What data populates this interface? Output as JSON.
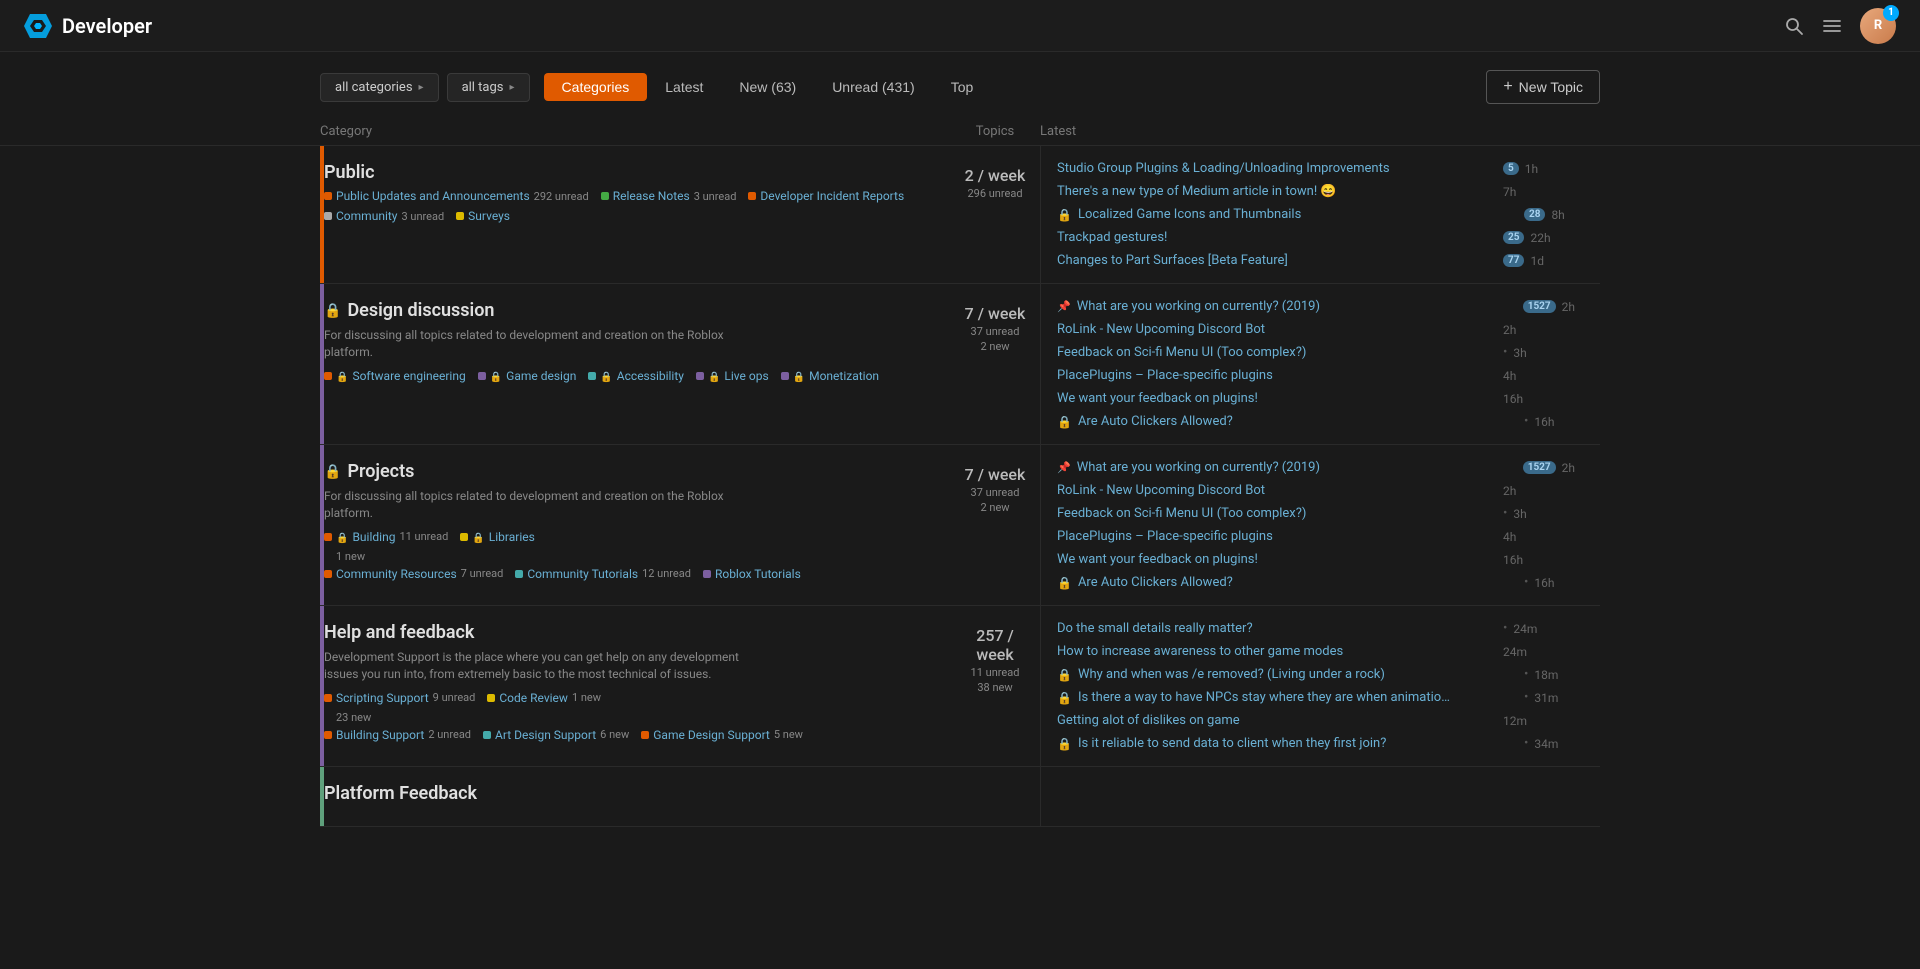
{
  "site": {
    "title": "Developer",
    "logo_text": "Developer"
  },
  "nav": {
    "search_label": "Search",
    "menu_label": "Menu",
    "notifications": "1",
    "avatar_initials": "R"
  },
  "filters": {
    "categories_label": "all categories",
    "tags_label": "all tags",
    "tabs": [
      {
        "id": "categories",
        "label": "Categories",
        "active": true
      },
      {
        "id": "latest",
        "label": "Latest",
        "active": false
      },
      {
        "id": "new",
        "label": "New (63)",
        "active": false
      },
      {
        "id": "unread",
        "label": "Unread (431)",
        "active": false
      },
      {
        "id": "top",
        "label": "Top",
        "active": false
      }
    ],
    "new_topic_label": "New Topic"
  },
  "table_headers": {
    "category": "Category",
    "topics": "Topics",
    "latest": "Latest"
  },
  "categories": [
    {
      "id": "public",
      "title": "Public",
      "locked": false,
      "color": "#e05a00",
      "stats": {
        "per_week": "2 / week",
        "unread": "296 unread"
      },
      "subcats": [
        {
          "color": "#e05a00",
          "name": "Public Updates and Announcements",
          "count": "292 unread",
          "locked": false
        },
        {
          "color": "#44aa44",
          "name": "Release Notes",
          "count": "3 unread",
          "locked": false
        },
        {
          "color": "#e05a00",
          "name": "Developer Incident Reports",
          "count": "",
          "locked": false
        },
        {
          "color": "#aaaaaa",
          "name": "Community",
          "count": "3 unread",
          "locked": false
        },
        {
          "color": "#ddbb00",
          "name": "Surveys",
          "count": "",
          "locked": false
        }
      ],
      "topics": [
        {
          "icon": "",
          "pin": false,
          "text": "Studio Group Plugins & Loading/Unloading Improvements",
          "badge": "5",
          "badge_type": "blue",
          "bullet": false,
          "time": "1h"
        },
        {
          "icon": "",
          "pin": false,
          "text": "There's a new type of Medium article in town! 😄",
          "badge": "",
          "badge_type": "",
          "bullet": false,
          "time": "7h"
        },
        {
          "icon": "🔒",
          "pin": false,
          "text": "Localized Game Icons and Thumbnails",
          "badge": "28",
          "badge_type": "blue",
          "bullet": false,
          "time": "8h"
        },
        {
          "icon": "",
          "pin": false,
          "text": "Trackpad gestures!",
          "badge": "25",
          "badge_type": "blue",
          "bullet": false,
          "time": "22h"
        },
        {
          "icon": "",
          "pin": false,
          "text": "Changes to Part Surfaces [Beta Feature]",
          "badge": "77",
          "badge_type": "blue",
          "bullet": false,
          "time": "1d"
        }
      ]
    },
    {
      "id": "design",
      "title": "Design discussion",
      "locked": true,
      "color": "#7c5fa0",
      "desc": "For discussing all topics related to development and creation on the Roblox platform.",
      "stats": {
        "per_week": "7 / week",
        "unread": "37 unread",
        "new": "2 new"
      },
      "subcats": [
        {
          "color": "#e05a00",
          "name": "Software engineering",
          "count": "",
          "locked": true
        },
        {
          "color": "#7c5fa0",
          "name": "Game design",
          "count": "",
          "locked": true
        },
        {
          "color": "#44aaaa",
          "name": "Accessibility",
          "count": "",
          "locked": true
        },
        {
          "color": "#7c5fa0",
          "name": "Live ops",
          "count": "",
          "locked": true
        },
        {
          "color": "#7c5fa0",
          "name": "Monetization",
          "count": "",
          "locked": true
        }
      ],
      "topics": [
        {
          "icon": "📌",
          "pin": true,
          "text": "What are you working on currently? (2019)",
          "badge": "1527",
          "badge_type": "blue",
          "bullet": false,
          "time": "2h"
        },
        {
          "icon": "",
          "pin": false,
          "text": "RoLink - New Upcoming Discord Bot",
          "badge": "",
          "badge_type": "",
          "bullet": false,
          "time": "2h"
        },
        {
          "icon": "",
          "pin": false,
          "text": "Feedback on Sci-fi Menu UI (Too complex?)",
          "badge": "",
          "badge_type": "",
          "bullet": true,
          "time": "3h"
        },
        {
          "icon": "",
          "pin": false,
          "text": "PlacePlugins – Place-specific plugins",
          "badge": "",
          "badge_type": "",
          "bullet": false,
          "time": "4h"
        },
        {
          "icon": "",
          "pin": false,
          "text": "We want your feedback on plugins!",
          "badge": "",
          "badge_type": "",
          "bullet": false,
          "time": "16h"
        },
        {
          "icon": "🔒",
          "pin": false,
          "text": "Are Auto Clickers Allowed?",
          "badge": "",
          "badge_type": "",
          "bullet": true,
          "time": "16h"
        }
      ]
    },
    {
      "id": "projects",
      "title": "Projects",
      "locked": true,
      "color": "#7c5fa0",
      "desc": "For discussing all topics related to development and creation on the Roblox platform.",
      "stats": {
        "per_week": "7 / week",
        "unread": "37 unread",
        "new": "2 new"
      },
      "subcats": [
        {
          "color": "#e05a00",
          "name": "Building",
          "count": "11 unread",
          "new": "1 new",
          "locked": true
        },
        {
          "color": "#ddbb00",
          "name": "Libraries",
          "count": "",
          "locked": true
        },
        {
          "color": "#e05a00",
          "name": "Community Resources",
          "count": "7 unread",
          "locked": false
        },
        {
          "color": "#44aaaa",
          "name": "Community Tutorials",
          "count": "12 unread",
          "locked": false
        },
        {
          "color": "#7c5fa0",
          "name": "Roblox Tutorials",
          "count": "",
          "locked": false
        }
      ],
      "topics": [
        {
          "icon": "📌",
          "pin": true,
          "text": "What are you working on currently? (2019)",
          "badge": "1527",
          "badge_type": "blue",
          "bullet": false,
          "time": "2h"
        },
        {
          "icon": "",
          "pin": false,
          "text": "RoLink - New Upcoming Discord Bot",
          "badge": "",
          "badge_type": "",
          "bullet": false,
          "time": "2h"
        },
        {
          "icon": "",
          "pin": false,
          "text": "Feedback on Sci-fi Menu UI (Too complex?)",
          "badge": "",
          "badge_type": "",
          "bullet": true,
          "time": "3h"
        },
        {
          "icon": "",
          "pin": false,
          "text": "PlacePlugins – Place-specific plugins",
          "badge": "",
          "badge_type": "",
          "bullet": false,
          "time": "4h"
        },
        {
          "icon": "",
          "pin": false,
          "text": "We want your feedback on plugins!",
          "badge": "",
          "badge_type": "",
          "bullet": false,
          "time": "16h"
        },
        {
          "icon": "🔒",
          "pin": false,
          "text": "Are Auto Clickers Allowed?",
          "badge": "",
          "badge_type": "",
          "bullet": true,
          "time": "16h"
        }
      ]
    },
    {
      "id": "help",
      "title": "Help and feedback",
      "locked": false,
      "color": "#7c5fa0",
      "desc": "Development Support is the place where you can get help on any development issues you run into, from extremely basic to the most technical of issues.",
      "stats": {
        "per_week": "257 / week",
        "unread": "11 unread",
        "new": "38 new"
      },
      "subcats": [
        {
          "color": "#e05a00",
          "name": "Scripting Support",
          "count": "9 unread",
          "new": "23 new",
          "locked": false
        },
        {
          "color": "#ddbb00",
          "name": "Code Review",
          "count": "1 new",
          "locked": false
        },
        {
          "color": "#e05a00",
          "name": "Building Support",
          "count": "2 unread",
          "locked": false
        },
        {
          "color": "#44aaaa",
          "name": "Art Design Support",
          "count": "6 new",
          "locked": false
        },
        {
          "color": "#e05a00",
          "name": "Game Design Support",
          "count": "5 new",
          "locked": false
        }
      ],
      "topics": [
        {
          "icon": "",
          "pin": false,
          "text": "Do the small details really matter?",
          "badge": "",
          "badge_type": "",
          "bullet": true,
          "time": "24m"
        },
        {
          "icon": "",
          "pin": false,
          "text": "How to increase awareness to other game modes",
          "badge": "",
          "badge_type": "",
          "bullet": false,
          "time": "24m"
        },
        {
          "icon": "🔒",
          "pin": false,
          "text": "Why and when was /e removed? (Living under a rock)",
          "badge": "",
          "badge_type": "",
          "bullet": true,
          "time": "18m"
        },
        {
          "icon": "🔒",
          "pin": false,
          "text": "Is there a way to have NPCs stay where they are when animatio…",
          "badge": "",
          "badge_type": "",
          "bullet": true,
          "time": "31m"
        },
        {
          "icon": "",
          "pin": false,
          "text": "Getting alot of dislikes on game",
          "badge": "",
          "badge_type": "",
          "bullet": false,
          "time": "12m"
        },
        {
          "icon": "🔒",
          "pin": false,
          "text": "Is it reliable to send data to client when they first join?",
          "badge": "",
          "badge_type": "",
          "bullet": true,
          "time": "34m"
        }
      ]
    }
  ]
}
